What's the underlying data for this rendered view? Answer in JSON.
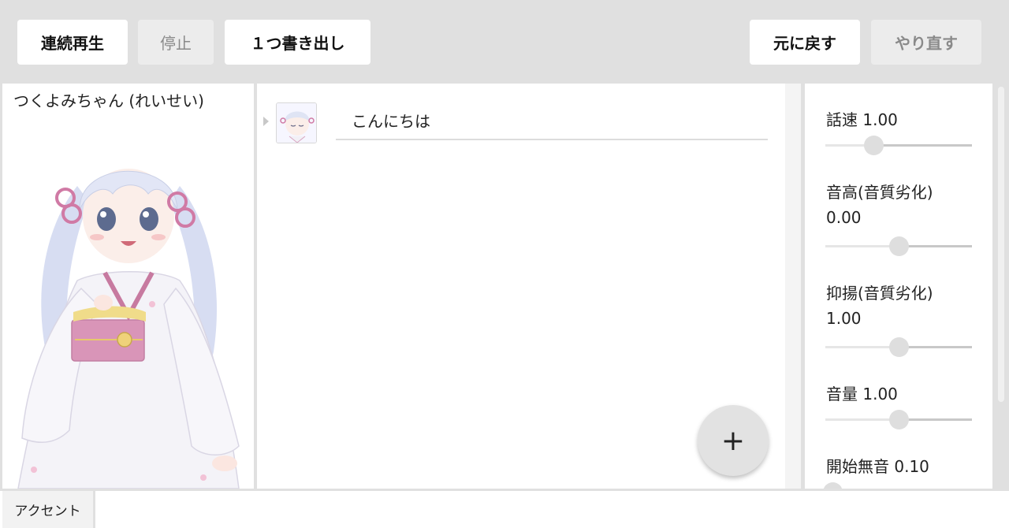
{
  "toolbar": {
    "play_all": "連続再生",
    "stop": "停止",
    "export_one": "１つ書き出し",
    "undo": "元に戻す",
    "redo": "やり直す"
  },
  "character": {
    "name": "つくよみちゃん (れいせい)"
  },
  "talk": {
    "rows": [
      {
        "text": "こんにちは"
      }
    ],
    "add_symbol": "+"
  },
  "parameters": [
    {
      "label": "話速",
      "value": "1.00",
      "level": 0.33
    },
    {
      "label": "音高(音質劣化)",
      "value": "0.00",
      "level": 0.5
    },
    {
      "label": "抑揚(音質劣化)",
      "value": "1.00",
      "level": 0.5
    },
    {
      "label": "音量",
      "value": "1.00",
      "level": 0.5
    },
    {
      "label": "開始無音",
      "value": "0.10",
      "level": 0.05
    }
  ],
  "bottom": {
    "accent_tab": "アクセント"
  },
  "icons": {
    "add": "plus-icon",
    "expand_row": "caret-right-icon"
  },
  "colors": {
    "background": "#e0e0e0",
    "panel": "#ffffff",
    "button_disabled": "#ececec"
  }
}
